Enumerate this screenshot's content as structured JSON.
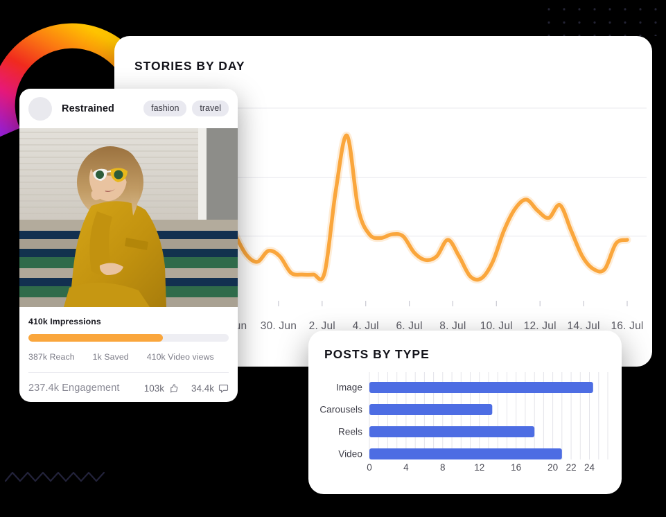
{
  "theme": {
    "background": "#000000",
    "card_bg": "#ffffff",
    "accent_orange": "#FAA63C",
    "accent_blue": "#4D6DE3",
    "text_dark": "#14141b",
    "text_muted": "#7c7c87",
    "grid_line": "#e8e8ee",
    "tag_bg": "#e9e9f0"
  },
  "decorations": {
    "arc_gradient_stops": [
      "#9B1FD6",
      "#E8197B",
      "#F02A1E",
      "#FB7A12",
      "#FFC400"
    ],
    "dot_grid_color": "#242436",
    "wave_color": "#1b1b2e"
  },
  "stories_card": {
    "title": "STORIES BY DAY"
  },
  "post_card": {
    "username": "Restrained",
    "tags": [
      "fashion",
      "travel"
    ],
    "avatar_icon": "avatar-placeholder-icon",
    "impressions_label": "410k Impressions",
    "progress_percent": 67,
    "substats": [
      "387k Reach",
      "1k Saved",
      "410k Video views"
    ],
    "engagement_label": "237.4k Engagement",
    "likes": "103k",
    "likes_icon": "thumbs-up-icon",
    "comments": "34.4k",
    "comments_icon": "comment-bubble-icon",
    "photo_alt": "woman in mustard outfit with sunglasses sitting on steps"
  },
  "posts_card": {
    "title": "POSTS BY TYPE"
  },
  "chart_data": [
    {
      "type": "line",
      "title": "STORIES BY DAY",
      "xlabel": "",
      "ylabel": "",
      "grid": true,
      "legend": "none",
      "tick_labels": [
        ". Jun",
        "30. Jun",
        "2. Jul",
        "4. Jul",
        "6. Jul",
        "8. Jul",
        "10. Jul",
        "12. Jul",
        "14. Jul",
        "16. Jul"
      ],
      "gridline_y_values": [
        100,
        62,
        30
      ],
      "ylim": [
        0,
        100
      ],
      "line_color": "#FAA63C",
      "x": [
        0,
        1,
        2,
        3,
        4,
        5,
        6,
        7,
        8,
        9,
        10,
        11,
        12,
        13,
        14,
        15,
        16,
        17,
        18,
        19,
        20,
        21,
        22,
        23,
        24,
        25,
        26,
        27,
        28,
        29,
        30,
        31,
        32,
        33,
        34,
        35
      ],
      "values": [
        31,
        20,
        16,
        22,
        19,
        10,
        9,
        9,
        10,
        55,
        85,
        45,
        31,
        29,
        31,
        30,
        21,
        17,
        19,
        28,
        19,
        8,
        7,
        16,
        33,
        45,
        50,
        44,
        40,
        47,
        33,
        19,
        12,
        12,
        26,
        28
      ]
    },
    {
      "type": "bar",
      "orientation": "horizontal",
      "title": "POSTS BY TYPE",
      "xlabel": "",
      "ylabel": "",
      "grid": true,
      "bar_color": "#4D6DE3",
      "categories": [
        "Image",
        "Carousels",
        "Reels",
        "Video"
      ],
      "values": [
        24.4,
        13.4,
        18.0,
        21.0
      ],
      "tick_labels": [
        "0",
        "4",
        "8",
        "12",
        "16",
        "20",
        "22",
        "24"
      ],
      "tick_values": [
        0,
        4,
        8,
        12,
        16,
        20,
        22,
        24
      ],
      "xlim": [
        0,
        26
      ]
    }
  ]
}
